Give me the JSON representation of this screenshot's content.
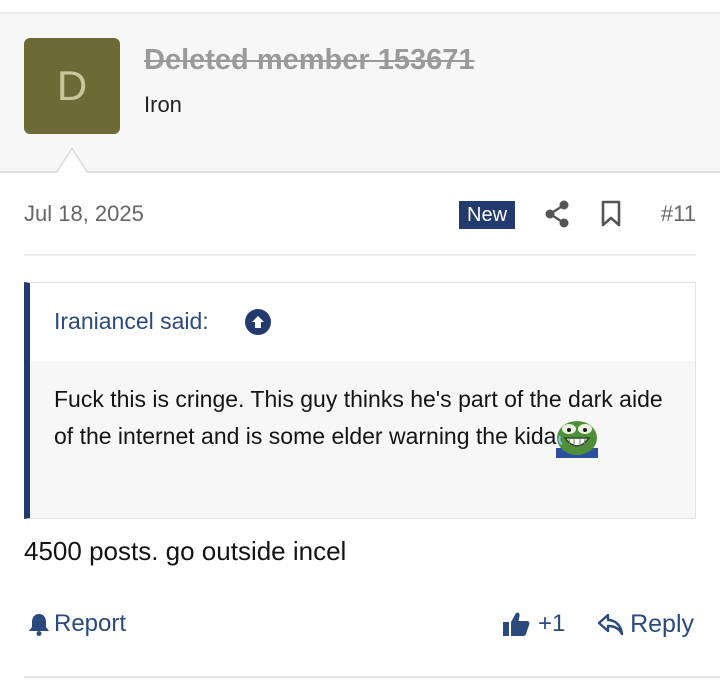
{
  "user": {
    "avatar_letter": "D",
    "name": "Deleted member 153671",
    "title": "Iron",
    "avatar_color": "#6e6a36"
  },
  "meta": {
    "date": "Jul 18, 2025",
    "badge": "New",
    "post_number": "#11",
    "share_icon": "share-icon",
    "bookmark_icon": "bookmark-icon"
  },
  "quote": {
    "author": "Iraniancel said:",
    "text": "Fuck this is cringe. This guy thinks he's part of the dark aide of the internet and is some elder warning the kida",
    "emoji": "pepe-laughing-emoji"
  },
  "message": "4500 posts. go outside incel",
  "actions": {
    "report": "Report",
    "like_count": "+1",
    "reply": "Reply"
  },
  "colors": {
    "accent": "#223a6e",
    "link": "#2b4a7e"
  }
}
